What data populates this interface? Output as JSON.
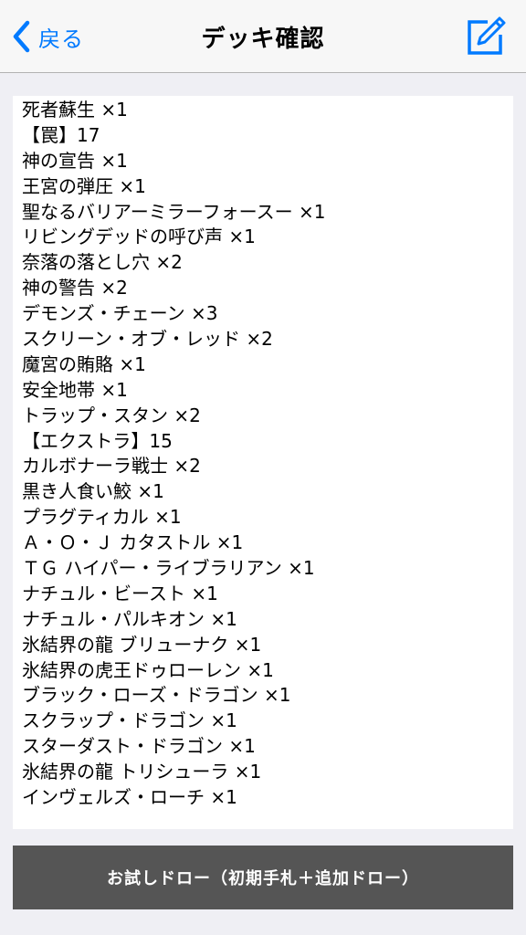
{
  "navbar": {
    "back_label": "戻る",
    "title": "デッキ確認",
    "accent_color": "#007aff"
  },
  "icons": {
    "back": "chevron-left-icon",
    "compose": "compose-icon"
  },
  "deck_list": {
    "lines": [
      "死者蘇生 ×1",
      "【罠】17",
      "神の宣告 ×1",
      "王宮の弾圧 ×1",
      "聖なるバリアーミラーフォースー ×1",
      "リビングデッドの呼び声 ×1",
      "奈落の落とし穴 ×2",
      "神の警告 ×2",
      "デモンズ・チェーン ×3",
      "スクリーン・オブ・レッド ×2",
      "魔宮の賄賂 ×1",
      "安全地帯 ×1",
      "トラップ・スタン ×2",
      "【エクストラ】15",
      "カルボナーラ戦士 ×2",
      "黒き人食い鮫 ×1",
      "プラグティカル ×1",
      "Ａ・Ｏ・Ｊ カタストル ×1",
      "ＴＧ ハイパー・ライブラリアン ×1",
      "ナチュル・ビースト ×1",
      "ナチュル・パルキオン ×1",
      "氷結界の龍 ブリューナク ×1",
      "氷結界の虎王ドゥローレン ×1",
      "ブラック・ローズ・ドラゴン ×1",
      "スクラップ・ドラゴン ×1",
      "スターダスト・ドラゴン ×1",
      "氷結界の龍 トリシューラ ×1",
      "インヴェルズ・ローチ ×1"
    ]
  },
  "draw_button": {
    "label": "お試しドロー（初期手札＋追加ドロー）",
    "color": "#555555"
  }
}
